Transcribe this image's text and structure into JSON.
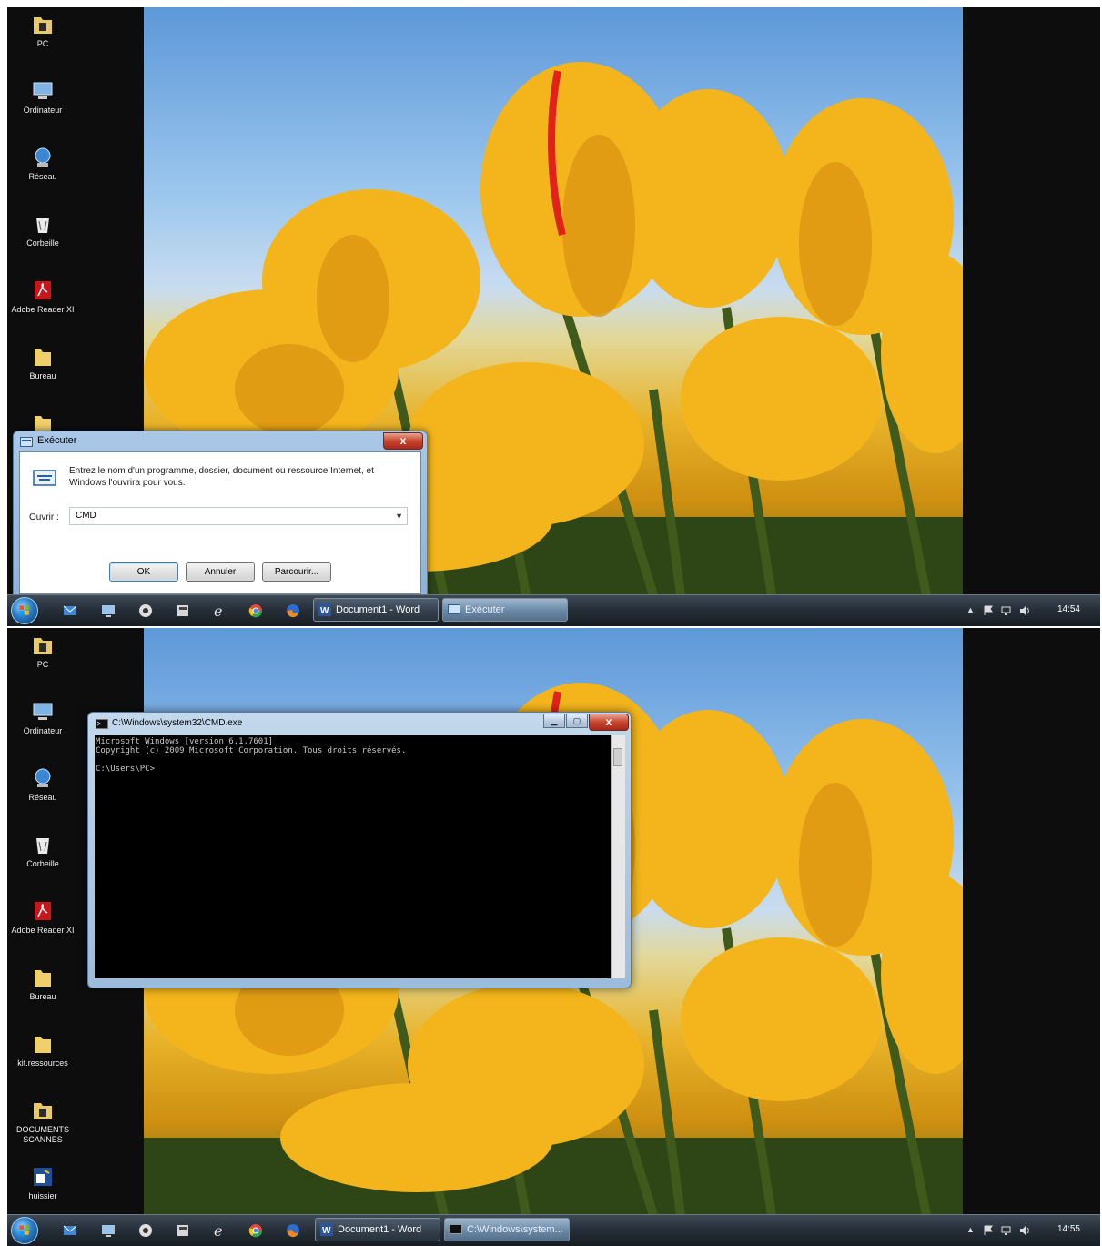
{
  "colors": {
    "taskbar": "#27303a",
    "wallpaper_sky": "#9cc7ee",
    "tulip": "#f2b51c",
    "close_button": "#c7452d"
  },
  "screenshot_top": {
    "desktop_icons": [
      {
        "label": "PC",
        "icon": "user-folder-icon"
      },
      {
        "label": "Ordinateur",
        "icon": "computer-icon"
      },
      {
        "label": "Réseau",
        "icon": "network-icon"
      },
      {
        "label": "Corbeille",
        "icon": "recycle-bin-icon"
      },
      {
        "label": "Adobe Reader XI",
        "icon": "adobe-reader-icon"
      },
      {
        "label": "Bureau",
        "icon": "folder-icon"
      }
    ],
    "run_dialog": {
      "title": "Exécuter",
      "close_label": "x",
      "message": "Entrez le nom d'un programme, dossier, document ou ressource Internet, et Windows l'ouvrira pour vous.",
      "open_label": "Ouvrir :",
      "open_value": "CMD",
      "ok_label": "OK",
      "cancel_label": "Annuler",
      "browse_label": "Parcourir..."
    },
    "taskbar": {
      "buttons": [
        {
          "label": "Document1 - Word",
          "active": false
        },
        {
          "label": "Exécuter",
          "active": true
        }
      ],
      "clock": "14:54"
    }
  },
  "screenshot_bottom": {
    "desktop_icons": [
      {
        "label": "PC",
        "icon": "user-folder-icon"
      },
      {
        "label": "Ordinateur",
        "icon": "computer-icon"
      },
      {
        "label": "Réseau",
        "icon": "network-icon"
      },
      {
        "label": "Corbeille",
        "icon": "recycle-bin-icon"
      },
      {
        "label": "Adobe Reader XI",
        "icon": "adobe-reader-icon"
      },
      {
        "label": "Bureau",
        "icon": "folder-icon"
      },
      {
        "label": "kit.ressources",
        "icon": "folder-icon"
      },
      {
        "label": "DOCUMENTS SCANNES",
        "icon": "user-folder-icon"
      },
      {
        "label": "huissier",
        "icon": "shortcut-icon"
      }
    ],
    "cmd_window": {
      "title": "C:\\Windows\\system32\\CMD.exe",
      "lines": [
        "Microsoft Windows [version 6.1.7601]",
        "Copyright (c) 2009 Microsoft Corporation. Tous droits réservés.",
        "",
        "C:\\Users\\PC>"
      ]
    },
    "taskbar": {
      "buttons": [
        {
          "label": "Document1 - Word",
          "active": false
        },
        {
          "label": "C:\\Windows\\system...",
          "active": true
        }
      ],
      "clock": "14:55"
    }
  }
}
